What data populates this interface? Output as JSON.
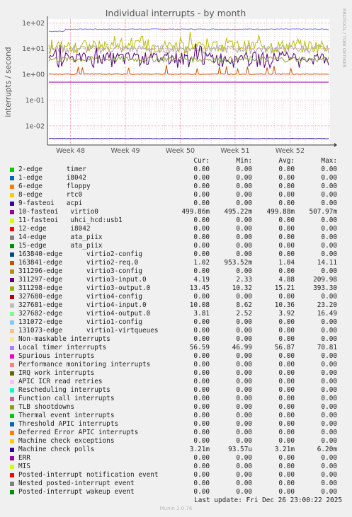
{
  "chart_data": {
    "type": "line",
    "title": "Individual interrupts - by month",
    "ylabel": "interrupts / second",
    "side_text": "RRDTOOL / TOBI OETIKER",
    "yscale": "log",
    "ylim": [
      0.0018,
      140
    ],
    "yticks": [
      {
        "value": 100,
        "label": "1e+02"
      },
      {
        "value": 10,
        "label": "1e+01"
      },
      {
        "value": 1,
        "label": "1e+00"
      },
      {
        "value": 0.1,
        "label": "1e-01"
      },
      {
        "value": 0.01,
        "label": "1e-02"
      }
    ],
    "x_categories": [
      "Week 48",
      "Week 49",
      "Week 50",
      "Week 51",
      "Week 52"
    ],
    "grid": true,
    "series": [
      {
        "name": "Local timer interrupts",
        "color": "#7777ff",
        "base": 56.6,
        "noise": 0.04,
        "step_at": 0.06,
        "pre_step": 47
      },
      {
        "name": "virtio3-output.0",
        "color": "#bbbb00",
        "base": 13.5,
        "noise": 0.55,
        "spiky": true
      },
      {
        "name": "virtio4-input.0",
        "color": "#aaaaaa",
        "base": 10,
        "noise": 0.35
      },
      {
        "name": "virtio3-input.0",
        "color": "#550077",
        "base": 4.5,
        "noise": 0.6,
        "spiky": true
      },
      {
        "name": "virtio4-output.0",
        "color": "#88aa44",
        "base": 3.9,
        "noise": 0.25
      },
      {
        "name": "virtio2-req.0",
        "color": "#cc5500",
        "base": 1.02,
        "noise": 0.03,
        "bumps": true
      },
      {
        "name": "virtio0",
        "color": "#990099",
        "base": 0.5,
        "noise": 0.0
      },
      {
        "name": "Machine check polls",
        "color": "#220099",
        "base": 0.0032,
        "noise": 0.02
      }
    ],
    "legend_header": {
      "cur": "Cur:",
      "min": "Min:",
      "avg": "Avg:",
      "max": "Max:"
    },
    "legend": [
      {
        "label": "2-edge      timer",
        "color": "#00cc00",
        "cur": "0.00",
        "min": "0.00",
        "avg": "0.00",
        "max": "0.00"
      },
      {
        "label": "1-edge      i8042",
        "color": "#0066b3",
        "cur": "0.00",
        "min": "0.00",
        "avg": "0.00",
        "max": "0.00"
      },
      {
        "label": "6-edge      floppy",
        "color": "#ff8000",
        "cur": "0.00",
        "min": "0.00",
        "avg": "0.00",
        "max": "0.00"
      },
      {
        "label": "8-edge      rtc0",
        "color": "#ffcc00",
        "cur": "0.00",
        "min": "0.00",
        "avg": "0.00",
        "max": "0.00"
      },
      {
        "label": "9-fasteoi   acpi",
        "color": "#330099",
        "cur": "0.00",
        "min": "0.00",
        "avg": "0.00",
        "max": "0.00"
      },
      {
        "label": "10-fasteoi   virtio0",
        "color": "#990099",
        "cur": "499.86m",
        "min": "495.22m",
        "avg": "499.88m",
        "max": "507.97m"
      },
      {
        "label": "11-fasteoi   uhci_hcd:usb1",
        "color": "#ccff00",
        "cur": "0.00",
        "min": "0.00",
        "avg": "0.00",
        "max": "0.00"
      },
      {
        "label": "12-edge      i8042",
        "color": "#ff0000",
        "cur": "0.00",
        "min": "0.00",
        "avg": "0.00",
        "max": "0.00"
      },
      {
        "label": "14-edge      ata_piix",
        "color": "#808080",
        "cur": "0.00",
        "min": "0.00",
        "avg": "0.00",
        "max": "0.00"
      },
      {
        "label": "15-edge      ata_piix",
        "color": "#008f00",
        "cur": "0.00",
        "min": "0.00",
        "avg": "0.00",
        "max": "0.00"
      },
      {
        "label": "163840-edge      virtio2-config",
        "color": "#00487d",
        "cur": "0.00",
        "min": "0.00",
        "avg": "0.00",
        "max": "0.00"
      },
      {
        "label": "163841-edge      virtio2-req.0",
        "color": "#b35a00",
        "cur": "1.02",
        "min": "953.52m",
        "avg": "1.04",
        "max": "14.11"
      },
      {
        "label": "311296-edge      virtio3-config",
        "color": "#b38f00",
        "cur": "0.00",
        "min": "0.00",
        "avg": "0.00",
        "max": "0.00"
      },
      {
        "label": "311297-edge      virtio3-input.0",
        "color": "#6b006b",
        "cur": "4.19",
        "min": "2.33",
        "avg": "4.88",
        "max": "209.98"
      },
      {
        "label": "311298-edge      virtio3-output.0",
        "color": "#8fb300",
        "cur": "13.45",
        "min": "10.32",
        "avg": "15.21",
        "max": "393.30"
      },
      {
        "label": "327680-edge      virtio4-config",
        "color": "#b30000",
        "cur": "0.00",
        "min": "0.00",
        "avg": "0.00",
        "max": "0.00"
      },
      {
        "label": "327681-edge      virtio4-input.0",
        "color": "#bebebe",
        "cur": "10.08",
        "min": "8.62",
        "avg": "10.36",
        "max": "23.20"
      },
      {
        "label": "327682-edge      virtio4-output.0",
        "color": "#80ff80",
        "cur": "3.81",
        "min": "2.52",
        "avg": "3.92",
        "max": "16.49"
      },
      {
        "label": "131072-edge      virtio1-config",
        "color": "#80c9ff",
        "cur": "0.00",
        "min": "0.00",
        "avg": "0.00",
        "max": "0.00"
      },
      {
        "label": "131073-edge      virtio1-virtqueues",
        "color": "#ffc080",
        "cur": "0.00",
        "min": "0.00",
        "avg": "0.00",
        "max": "0.00"
      },
      {
        "label": "Non-maskable interrupts",
        "color": "#ffe680",
        "cur": "0.00",
        "min": "0.00",
        "avg": "0.00",
        "max": "0.00"
      },
      {
        "label": "Local timer interrupts",
        "color": "#aa80ff",
        "cur": "56.59",
        "min": "46.99",
        "avg": "56.87",
        "max": "70.81"
      },
      {
        "label": "Spurious interrupts",
        "color": "#ee00cc",
        "cur": "0.00",
        "min": "0.00",
        "avg": "0.00",
        "max": "0.00"
      },
      {
        "label": "Performance monitoring interrupts",
        "color": "#ff8080",
        "cur": "0.00",
        "min": "0.00",
        "avg": "0.00",
        "max": "0.00"
      },
      {
        "label": "IRQ work interrupts",
        "color": "#666600",
        "cur": "0.00",
        "min": "0.00",
        "avg": "0.00",
        "max": "0.00"
      },
      {
        "label": "APIC ICR read retries",
        "color": "#ffbfff",
        "cur": "0.00",
        "min": "0.00",
        "avg": "0.00",
        "max": "0.00"
      },
      {
        "label": "Rescheduling interrupts",
        "color": "#00ffcc",
        "cur": "0.00",
        "min": "0.00",
        "avg": "0.00",
        "max": "0.00"
      },
      {
        "label": "Function call interrupts",
        "color": "#cc6699",
        "cur": "0.00",
        "min": "0.00",
        "avg": "0.00",
        "max": "0.00"
      },
      {
        "label": "TLB shootdowns",
        "color": "#999900",
        "cur": "0.00",
        "min": "0.00",
        "avg": "0.00",
        "max": "0.00"
      },
      {
        "label": "Thermal event interrupts",
        "color": "#00cc00",
        "cur": "0.00",
        "min": "0.00",
        "avg": "0.00",
        "max": "0.00"
      },
      {
        "label": "Threshold APIC interrupts",
        "color": "#0066b3",
        "cur": "0.00",
        "min": "0.00",
        "avg": "0.00",
        "max": "0.00"
      },
      {
        "label": "Deferred Error APIC interrupts",
        "color": "#ff8000",
        "cur": "0.00",
        "min": "0.00",
        "avg": "0.00",
        "max": "0.00"
      },
      {
        "label": "Machine check exceptions",
        "color": "#ffcc00",
        "cur": "0.00",
        "min": "0.00",
        "avg": "0.00",
        "max": "0.00"
      },
      {
        "label": "Machine check polls",
        "color": "#330099",
        "cur": "3.21m",
        "min": "93.57u",
        "avg": "3.21m",
        "max": "6.20m"
      },
      {
        "label": "ERR",
        "color": "#990099",
        "cur": "0.00",
        "min": "0.00",
        "avg": "0.00",
        "max": "0.00"
      },
      {
        "label": "MIS",
        "color": "#ccff00",
        "cur": "0.00",
        "min": "0.00",
        "avg": "0.00",
        "max": "0.00"
      },
      {
        "label": "Posted-interrupt notification event",
        "color": "#ff0000",
        "cur": "0.00",
        "min": "0.00",
        "avg": "0.00",
        "max": "0.00"
      },
      {
        "label": "Nested posted-interrupt event",
        "color": "#808080",
        "cur": "0.00",
        "min": "0.00",
        "avg": "0.00",
        "max": "0.00"
      },
      {
        "label": "Posted-interrupt wakeup event",
        "color": "#008f00",
        "cur": "0.00",
        "min": "0.00",
        "avg": "0.00",
        "max": "0.00"
      }
    ]
  },
  "footer": {
    "last_update": "Last update: Fri Dec 26 23:00:22 2025",
    "generator": "Munin 2.0.76"
  }
}
